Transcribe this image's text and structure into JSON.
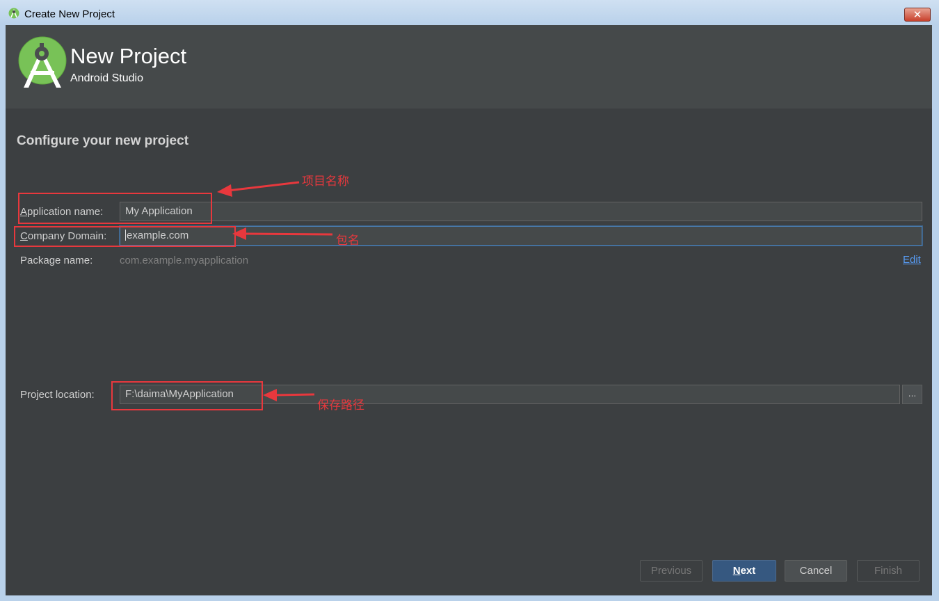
{
  "window": {
    "title": "Create New Project",
    "close_label": "✕"
  },
  "header": {
    "title": "New Project",
    "subtitle": "Android Studio"
  },
  "section": {
    "title": "Configure your new project"
  },
  "form": {
    "app_name_label_key": "A",
    "app_name_label_rest": "pplication name:",
    "app_name_value": "My Application",
    "company_label_key": "C",
    "company_label_rest": "ompany Domain:",
    "company_value": "example.com",
    "package_label": "Package name:",
    "package_value": "com.example.myapplication",
    "edit_link": "Edit",
    "location_label": "Project location:",
    "location_value": "F:\\daima\\MyApplication",
    "browse_label": "..."
  },
  "buttons": {
    "previous": "Previous",
    "next_key": "N",
    "next_rest": "ext",
    "cancel": "Cancel",
    "finish": "Finish"
  },
  "annotations": {
    "project_name": "项目名称",
    "package": "包名",
    "save_path": "保存路径",
    "color": "#e8383d"
  },
  "colors": {
    "dialog_bg": "#3c3f41",
    "header_bg": "#45494a",
    "accent": "#365880",
    "link": "#589df6"
  }
}
